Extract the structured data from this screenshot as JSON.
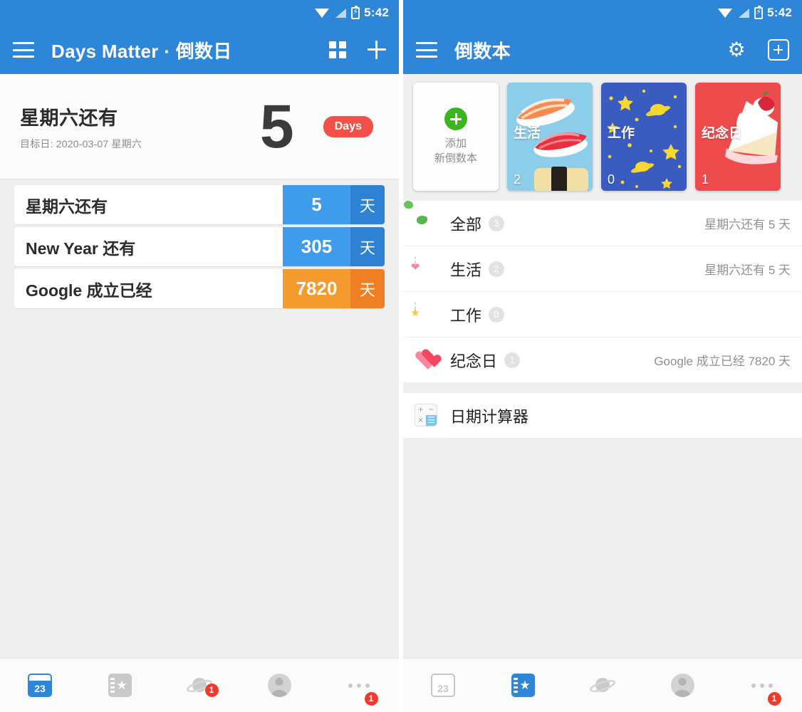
{
  "statusbar": {
    "time": "5:42",
    "wifi_icon": "wifi-icon",
    "signal_icon": "signal-icon",
    "battery_icon": "battery-charging-icon"
  },
  "left": {
    "appbar": {
      "title": "Days Matter · 倒数日",
      "menu_icon": "hamburger-icon",
      "grid_icon": "grid-view-icon",
      "add_icon": "plus-icon"
    },
    "hero": {
      "title": "星期六还有",
      "subtitle": "目标日: 2020-03-07 星期六",
      "number": "5",
      "unit_pill": "Days",
      "pill_color": "#f4504a"
    },
    "events": [
      {
        "name": "星期六还有",
        "value": "5",
        "unit": "天",
        "color": "#3f9bec",
        "color_dark": "#2e82d4"
      },
      {
        "name": "New Year 还有",
        "value": "305",
        "unit": "天",
        "color": "#3f9bec",
        "color_dark": "#2e82d4"
      },
      {
        "name": "Google 成立已经",
        "value": "7820",
        "unit": "天",
        "color": "#f59a2e",
        "color_dark": "#ee7f22"
      }
    ],
    "bottomnav": [
      {
        "name": "calendar",
        "label": "23",
        "active": true,
        "badge": ""
      },
      {
        "name": "notebook",
        "label": "",
        "active": false,
        "badge": ""
      },
      {
        "name": "planet",
        "label": "",
        "active": false,
        "badge": "1"
      },
      {
        "name": "profile",
        "label": "",
        "active": false,
        "badge": ""
      },
      {
        "name": "more",
        "label": "",
        "active": false,
        "badge": "1"
      }
    ]
  },
  "right": {
    "appbar": {
      "title": "倒数本",
      "menu_icon": "hamburger-icon",
      "settings_icon": "gear-icon",
      "add_icon": "boxed-plus-icon"
    },
    "notebook_cards": [
      {
        "type": "add",
        "line1": "添加",
        "line2": "新倒数本",
        "plus_color": "#3cb521"
      },
      {
        "type": "cover",
        "title": "生活",
        "count": "2",
        "art": "sushi",
        "bg": "#8ccdea"
      },
      {
        "type": "cover",
        "title": "工作",
        "count": "0",
        "art": "stars",
        "bg": "#3a5cc0"
      },
      {
        "type": "cover",
        "title": "纪念日",
        "count": "1",
        "art": "cake",
        "bg": "#ee4c4c"
      }
    ],
    "notebook_list": [
      {
        "icon": "globe-icon",
        "label": "全部",
        "count": "3",
        "trailing": "星期六还有 5 天"
      },
      {
        "icon": "calendar-heart-icon",
        "label": "生活",
        "count": "2",
        "trailing": "星期六还有 5 天"
      },
      {
        "icon": "calendar-star-icon",
        "label": "工作",
        "count": "0",
        "trailing": ""
      },
      {
        "icon": "hearts-icon",
        "label": "纪念日",
        "count": "1",
        "trailing": "Google 成立已经 7820 天"
      }
    ],
    "tools": [
      {
        "icon": "calculator-icon",
        "label": "日期计算器"
      }
    ],
    "bottomnav": [
      {
        "name": "calendar",
        "label": "23",
        "active": false,
        "badge": ""
      },
      {
        "name": "notebook",
        "label": "",
        "active": true,
        "badge": ""
      },
      {
        "name": "planet",
        "label": "",
        "active": false,
        "badge": ""
      },
      {
        "name": "profile",
        "label": "",
        "active": false,
        "badge": ""
      },
      {
        "name": "more",
        "label": "",
        "active": false,
        "badge": "1"
      }
    ]
  }
}
